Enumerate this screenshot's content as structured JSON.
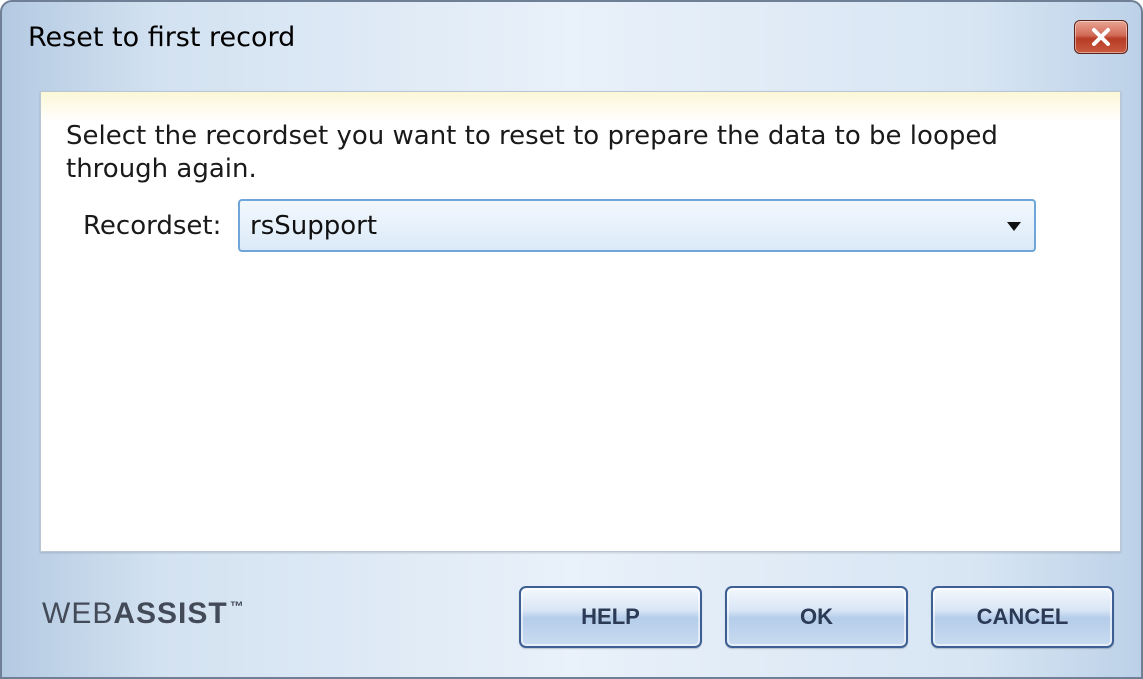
{
  "window": {
    "title": "Reset to first record"
  },
  "panel": {
    "instruction": "Select the recordset you want to reset to prepare the data to be looped through again.",
    "recordset_label": "Recordset:",
    "recordset_value": "rsSupport"
  },
  "footer": {
    "logo_web": "WEB",
    "logo_assist": "ASSIST",
    "logo_tm": "™",
    "help_label": "HELP",
    "ok_label": "OK",
    "cancel_label": "CANCEL"
  },
  "icons": {
    "close": "close-icon",
    "dropdown": "chevron-down-icon"
  },
  "colors": {
    "close_button": "#c44d36",
    "select_border": "#6fa5d8",
    "button_text": "#2b3a55",
    "logo": "#434a58"
  }
}
